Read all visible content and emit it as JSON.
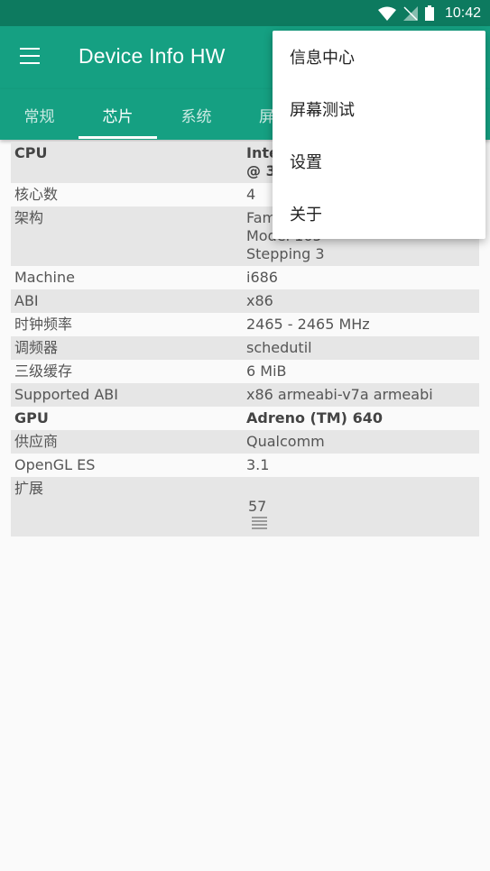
{
  "status": {
    "time": "10:42"
  },
  "app": {
    "title": "Device Info HW"
  },
  "tabs": [
    {
      "label": "常规"
    },
    {
      "label": "芯片"
    },
    {
      "label": "系统"
    },
    {
      "label": "屏"
    }
  ],
  "table": {
    "cpu": {
      "k": "CPU",
      "v": "Inte\n@ 3"
    },
    "cores": {
      "k": "核心数",
      "v": "4"
    },
    "arch": {
      "k": "架构",
      "v": "Fam\nModel 165\nStepping 3"
    },
    "machine": {
      "k": "Machine",
      "v": "i686"
    },
    "abi": {
      "k": "ABI",
      "v": "x86"
    },
    "clock": {
      "k": "时钟频率",
      "v": "2465 - 2465 MHz"
    },
    "governor": {
      "k": "调频器",
      "v": "schedutil"
    },
    "l3": {
      "k": "三级缓存",
      "v": "6 MiB"
    },
    "supported_abi": {
      "k": "Supported ABI",
      "v": "x86 armeabi-v7a armeabi"
    },
    "gpu": {
      "k": "GPU",
      "v": "Adreno (TM) 640"
    },
    "vendor": {
      "k": "供应商",
      "v": "Qualcomm"
    },
    "opengl": {
      "k": "OpenGL ES",
      "v": "3.1"
    },
    "ext": {
      "k": "扩展",
      "v": "57"
    }
  },
  "menu": {
    "items": [
      {
        "label": "信息中心"
      },
      {
        "label": "屏幕测试"
      },
      {
        "label": "设置"
      },
      {
        "label": "关于"
      }
    ]
  }
}
